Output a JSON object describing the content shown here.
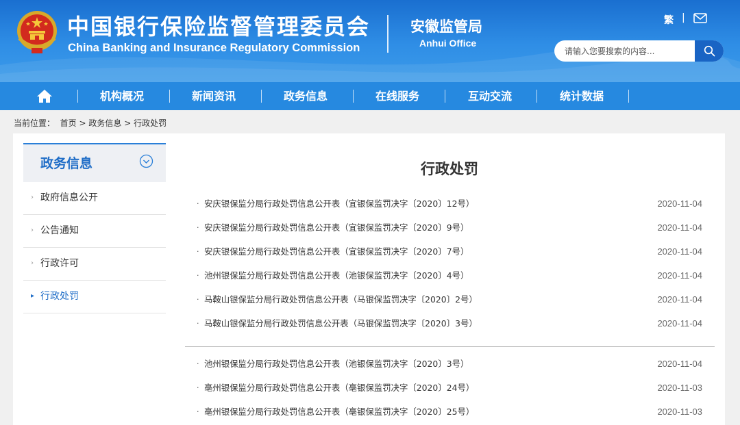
{
  "header": {
    "title_cn": "中国银行保险监督管理委员会",
    "title_en": "China Banking and Insurance Regulatory Commission",
    "office_cn": "安徽监管局",
    "office_en": "Anhui Office",
    "traditional_label": "繁",
    "separator": "|",
    "mail_icon": "mail-icon",
    "emblem": "national-emblem",
    "search": {
      "placeholder": "请输入您要搜索的内容...",
      "button_icon": "search-icon"
    }
  },
  "colors": {
    "header_bg": "#1a6fd0",
    "nav_bg": "#2689e0",
    "accent": "#1f6dc7"
  },
  "nav": {
    "home_icon": "home-icon",
    "items": [
      {
        "label": "机构概况"
      },
      {
        "label": "新闻资讯"
      },
      {
        "label": "政务信息"
      },
      {
        "label": "在线服务"
      },
      {
        "label": "互动交流"
      },
      {
        "label": "统计数据"
      }
    ]
  },
  "breadcrumb": {
    "prefix": "当前位置：",
    "home": "首页",
    "sep": ">",
    "level1": "政务信息",
    "level2": "行政处罚"
  },
  "sidebar": {
    "title": "政务信息",
    "toggle_icon": "chevron-down-circle-icon",
    "items": [
      {
        "label": "政府信息公开",
        "active": false
      },
      {
        "label": "公告通知",
        "active": false
      },
      {
        "label": "行政许可",
        "active": false
      },
      {
        "label": "行政处罚",
        "active": true
      }
    ]
  },
  "main": {
    "title": "行政处罚",
    "bullet": "·",
    "articles": [
      {
        "title": "安庆银保监分局行政处罚信息公开表（宜银保监罚决字〔2020〕12号）",
        "date": "2020-11-04"
      },
      {
        "title": "安庆银保监分局行政处罚信息公开表（宜银保监罚决字〔2020〕9号）",
        "date": "2020-11-04"
      },
      {
        "title": "安庆银保监分局行政处罚信息公开表（宜银保监罚决字〔2020〕7号）",
        "date": "2020-11-04"
      },
      {
        "title": "池州银保监分局行政处罚信息公开表（池银保监罚决字〔2020〕4号）",
        "date": "2020-11-04"
      },
      {
        "title": "马鞍山银保监分局行政处罚信息公开表（马银保监罚决字〔2020〕2号）",
        "date": "2020-11-04"
      },
      {
        "title": "马鞍山银保监分局行政处罚信息公开表（马银保监罚决字〔2020〕3号）",
        "date": "2020-11-04"
      },
      {
        "title": "池州银保监分局行政处罚信息公开表（池银保监罚决字〔2020〕3号）",
        "date": "2020-11-04"
      },
      {
        "title": "亳州银保监分局行政处罚信息公开表（亳银保监罚决字〔2020〕24号）",
        "date": "2020-11-03"
      },
      {
        "title": "亳州银保监分局行政处罚信息公开表（亳银保监罚决字〔2020〕25号）",
        "date": "2020-11-03"
      }
    ]
  }
}
